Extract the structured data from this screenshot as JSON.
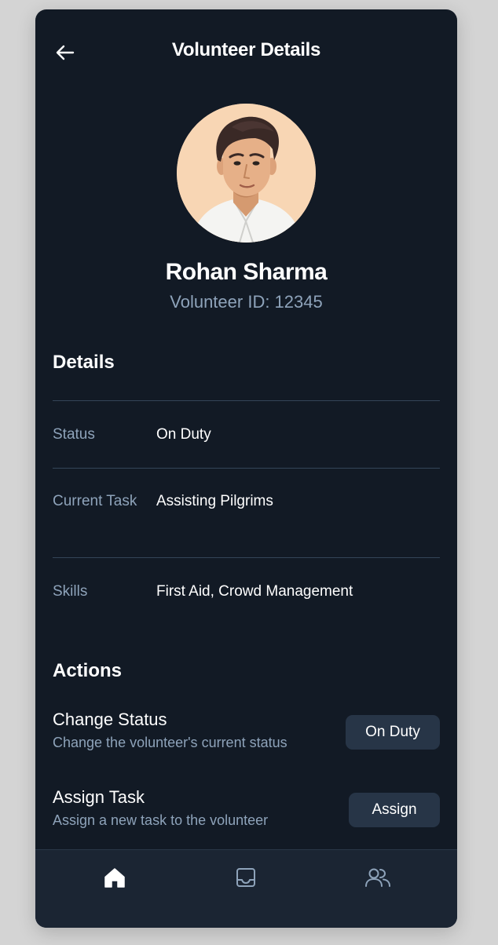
{
  "header": {
    "title": "Volunteer Details",
    "back_icon": "arrow-left-icon"
  },
  "profile": {
    "name": "Rohan Sharma",
    "id_text": "Volunteer ID: 12345",
    "avatar_icon": "volunteer-avatar"
  },
  "details": {
    "title": "Details",
    "rows": [
      {
        "label": "Status",
        "value": "On Duty"
      },
      {
        "label": "Current Task",
        "value": "Assisting Pilgrims"
      },
      {
        "label": "Skills",
        "value": "First Aid, Crowd Management"
      }
    ]
  },
  "actions": {
    "title": "Actions",
    "items": [
      {
        "title": "Change Status",
        "description": "Change the volunteer's current status",
        "button_label": "On Duty"
      },
      {
        "title": "Assign Task",
        "description": "Assign a new task to the volunteer",
        "button_label": "Assign"
      }
    ]
  },
  "bottom_nav": {
    "items": [
      {
        "icon": "home-icon",
        "active": true
      },
      {
        "icon": "inbox-icon",
        "active": false
      },
      {
        "icon": "people-icon",
        "active": false
      }
    ]
  },
  "colors": {
    "background": "#121a25",
    "nav_background": "#1b2533",
    "button_background": "#273547",
    "muted_text": "#8ea3ba",
    "divider": "#344558",
    "avatar_background": "#f8d6b4"
  }
}
